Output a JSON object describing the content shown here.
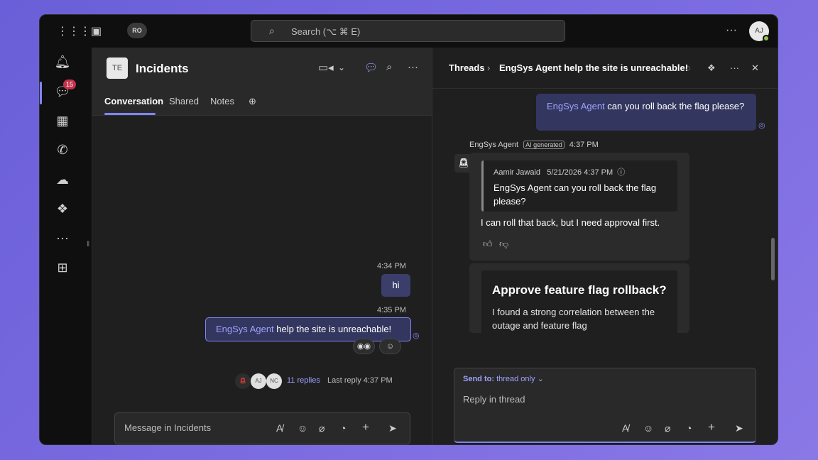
{
  "titlebar": {
    "apps_icon": "grid-icon",
    "sidebar_toggle_icon": "sidebar-icon",
    "account_initials": "RO",
    "search_placeholder": "Search (⌥ ⌘ E)",
    "more": "···",
    "user_initials": "AJ"
  },
  "rail": {
    "items": [
      {
        "name": "activity",
        "icon": "bell-icon"
      },
      {
        "name": "chat",
        "icon": "chat-icon",
        "badge": "15"
      },
      {
        "name": "calendar",
        "icon": "calendar-icon"
      },
      {
        "name": "calls",
        "icon": "phone-icon"
      },
      {
        "name": "onedrive",
        "icon": "cloud-icon"
      },
      {
        "name": "copilot",
        "icon": "copilot-icon"
      },
      {
        "name": "more",
        "icon": "ellipsis-icon"
      },
      {
        "name": "apps",
        "icon": "add-app-icon"
      }
    ]
  },
  "channel": {
    "tile": "TE",
    "title": "Incidents",
    "tabs": [
      "Conversation",
      "Shared",
      "Notes"
    ],
    "messages": {
      "time1": "4:34 PM",
      "msg1": "hi",
      "time2": "4:35 PM",
      "msg2_mention": "EngSys Agent",
      "msg2_text": " help the site is unreachable!",
      "replies": "11 replies",
      "last_reply": "Last reply 4:37 PM",
      "participants": [
        "AJ",
        "NC"
      ]
    },
    "composer_placeholder": "Message in Incidents"
  },
  "thread": {
    "crumb_root": "Threads",
    "crumb_title": "EngSys Agent help the site is unreachable!",
    "user_msg_mention": "EngSys Agent",
    "user_msg_text": " can you roll back the flag please?",
    "agent_name": "EngSys Agent",
    "ai_tag": "AI generated",
    "agent_time": "4:37 PM",
    "quote_author": "Aamir Jawaid",
    "quote_time": "5/21/2026 4:37 PM",
    "quote_text": "EngSys Agent can you roll back the flag please?",
    "agent_reply": "I can roll that back, but I need approval first.",
    "card_title": "Approve feature flag rollback?",
    "card_text": "I found a strong correlation between the outage and feature flag",
    "send_to_label": "Send to:",
    "send_to_value": "thread only",
    "reply_placeholder": "Reply in thread"
  },
  "colors": {
    "accent": "#7f85f5",
    "badge": "#c4314b",
    "presence": "#92c353"
  }
}
